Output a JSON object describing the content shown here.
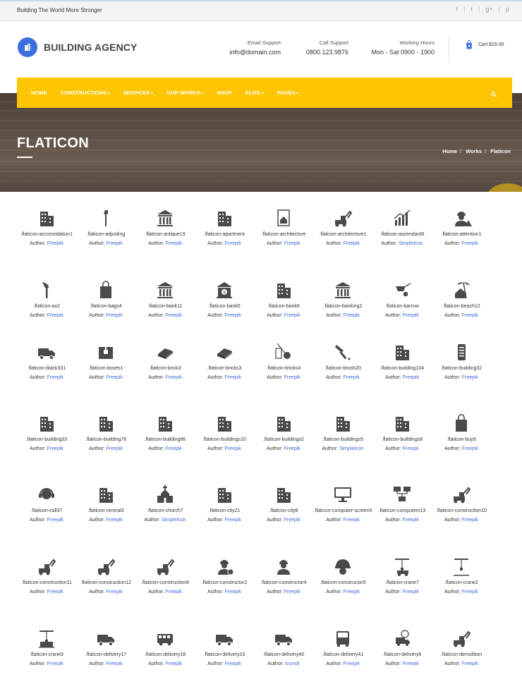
{
  "topbar": {
    "tagline": "Building The World More Stronger",
    "social": [
      "f",
      "t",
      "g+",
      "p"
    ]
  },
  "header": {
    "logo": "BUILDING AGENCY",
    "email_label": "Email Support",
    "email": "info@domain.com",
    "call_label": "Call Support",
    "phone": "0800.123.9876",
    "hours_label": "Working Hours",
    "hours": "Mon - Sat 0900 - 1900",
    "cart": "Cart $16.00"
  },
  "nav": {
    "items": [
      "HOME",
      "CONSTRUCTIONS",
      "SERVICES",
      "OUR WORKS",
      "SHOP",
      "BLOG",
      "PAGES"
    ],
    "dropdown_arrows": [
      false,
      true,
      true,
      true,
      false,
      true,
      true
    ]
  },
  "hero": {
    "title": "FLATICON",
    "crumbs": [
      "Home",
      "Works",
      "Flaticon"
    ]
  },
  "author_label": "Author:",
  "icons": [
    {
      "name": ".flaticon-accomodation1",
      "author": "Freepik",
      "glyph": "building-h-icon"
    },
    {
      "name": ".flaticon-adjusting",
      "author": "Freepik",
      "glyph": "wrench-icon"
    },
    {
      "name": ".flaticon-antique19",
      "author": "Freepik",
      "glyph": "temple-icon"
    },
    {
      "name": ".flaticon-apartment",
      "author": "Freepik",
      "glyph": "apartment-icon"
    },
    {
      "name": ".flaticon-architecture",
      "author": "Freepik",
      "glyph": "blueprint-icon"
    },
    {
      "name": ".flaticon-architecture1",
      "author": "Freepik",
      "glyph": "tower-crane-icon"
    },
    {
      "name": ".flaticon-ascendant6",
      "author": "SimpleIcon",
      "glyph": "chart-up-icon"
    },
    {
      "name": ".flaticon-attention1",
      "author": "Freepik",
      "glyph": "worker-warning-icon"
    },
    {
      "name": ".flaticon-ax2",
      "author": "Freepik",
      "glyph": "axe-icon"
    },
    {
      "name": ".flaticon-bags4",
      "author": "Freepik",
      "glyph": "bag-icon"
    },
    {
      "name": ".flaticon-bank11",
      "author": "Freepik",
      "glyph": "bank-icon"
    },
    {
      "name": ".flaticon-bank5",
      "author": "Freepik",
      "glyph": "bank-dollar-icon"
    },
    {
      "name": ".flaticon-bank6",
      "author": "Freepik",
      "glyph": "bank-building-icon"
    },
    {
      "name": ".flaticon-banking2",
      "author": "Freepik",
      "glyph": "bank-columns-icon"
    },
    {
      "name": ".flaticon-barrow",
      "author": "Freepik",
      "glyph": "wheelbarrow-icon"
    },
    {
      "name": ".flaticon-beach12",
      "author": "Freepik",
      "glyph": "beach-house-icon"
    },
    {
      "name": ".flaticon-black331",
      "author": "Freepik",
      "glyph": "van-icon"
    },
    {
      "name": ".flaticon-boxes1",
      "author": "Freepik",
      "glyph": "box-icon"
    },
    {
      "name": ".flaticon-brick3",
      "author": "Freepik",
      "glyph": "brick-icon"
    },
    {
      "name": ".flaticon-bricks3",
      "author": "Freepik",
      "glyph": "bricks-icon"
    },
    {
      "name": ".flaticon-bricks4",
      "author": "Freepik",
      "glyph": "wrecking-ball-icon"
    },
    {
      "name": ".flaticon-brush20",
      "author": "Freepik",
      "glyph": "paint-brush-icon"
    },
    {
      "name": ".flaticon-building104",
      "author": "Freepik",
      "glyph": "office-building-icon"
    },
    {
      "name": ".flaticon-building32",
      "author": "Freepik",
      "glyph": "tower-icon"
    },
    {
      "name": ".flaticon-building33",
      "author": "Freepik",
      "glyph": "apartment-block-icon"
    },
    {
      "name": ".flaticon-building78",
      "author": "Freepik",
      "glyph": "offices-icon"
    },
    {
      "name": ".flaticon-building86",
      "author": "Freepik",
      "glyph": "building-3d-icon"
    },
    {
      "name": ".flaticon-buildings10",
      "author": "Freepik",
      "glyph": "buildings-flat-icon"
    },
    {
      "name": ".flaticon-buildings2",
      "author": "Freepik",
      "glyph": "skyline-icon"
    },
    {
      "name": ".flaticon-buildings5",
      "author": "SimpleIcon",
      "glyph": "city-blocks-icon"
    },
    {
      "name": ".flaticon-buildings8",
      "author": "Freepik",
      "glyph": "city-trees-icon"
    },
    {
      "name": ".flaticon-buy9",
      "author": "Freepik",
      "glyph": "shopping-bag-icon"
    },
    {
      "name": ".flaticon-call37",
      "author": "Freepik",
      "glyph": "headset-icon"
    },
    {
      "name": ".flaticon-central3",
      "author": "Freepik",
      "glyph": "central-building-icon"
    },
    {
      "name": ".flaticon-church7",
      "author": "SimpleIcon",
      "glyph": "church-icon"
    },
    {
      "name": ".flaticon-city21",
      "author": "Freepik",
      "glyph": "city-icon"
    },
    {
      "name": ".flaticon-city8",
      "author": "Freepik",
      "glyph": "city-towers-icon"
    },
    {
      "name": ".flaticon-computer-screen5",
      "author": "Freepik",
      "glyph": "monitor-icon"
    },
    {
      "name": ".flaticon-computers13",
      "author": "Freepik",
      "glyph": "network-icon"
    },
    {
      "name": ".flaticon-construction10",
      "author": "Freepik",
      "glyph": "excavator-icon"
    },
    {
      "name": ".flaticon-construction11",
      "author": "Freepik",
      "glyph": "digger-icon"
    },
    {
      "name": ".flaticon-construction12",
      "author": "Freepik",
      "glyph": "mixer-truck-icon"
    },
    {
      "name": ".flaticon-construction9",
      "author": "Freepik",
      "glyph": "bulldozer-icon"
    },
    {
      "name": ".flaticon-constructor2",
      "author": "Freepik",
      "glyph": "engineer-gear-icon"
    },
    {
      "name": ".flaticon-constructor4",
      "author": "Freepik",
      "glyph": "worker-icon"
    },
    {
      "name": ".flaticon-constructor5",
      "author": "Freepik",
      "glyph": "helmet-icon"
    },
    {
      "name": ".flaticon-crane7",
      "author": "Freepik",
      "glyph": "crane-truck-icon"
    },
    {
      "name": ".flaticon-crane2",
      "author": "Freepik",
      "glyph": "crane-hook-icon"
    },
    {
      "name": ".flaticon-crane9",
      "author": "Freepik",
      "glyph": "container-crane-icon"
    },
    {
      "name": ".flaticon-delivery17",
      "author": "Freepik",
      "glyph": "delivery-truck-icon"
    },
    {
      "name": ".flaticon-delivery18",
      "author": "Freepik",
      "glyph": "bus-icon"
    },
    {
      "name": ".flaticon-delivery23",
      "author": "Freepik",
      "glyph": "truck-icon"
    },
    {
      "name": ".flaticon-delivery40",
      "author": "Icons8",
      "glyph": "lorry-icon"
    },
    {
      "name": ".flaticon-delivery41",
      "author": "Freepik",
      "glyph": "truck-front-icon"
    },
    {
      "name": ".flaticon-delivery6",
      "author": "Freepik",
      "glyph": "fast-delivery-icon"
    },
    {
      "name": ".flaticon-demolition",
      "author": "Freepik",
      "glyph": "demolition-icon"
    }
  ]
}
